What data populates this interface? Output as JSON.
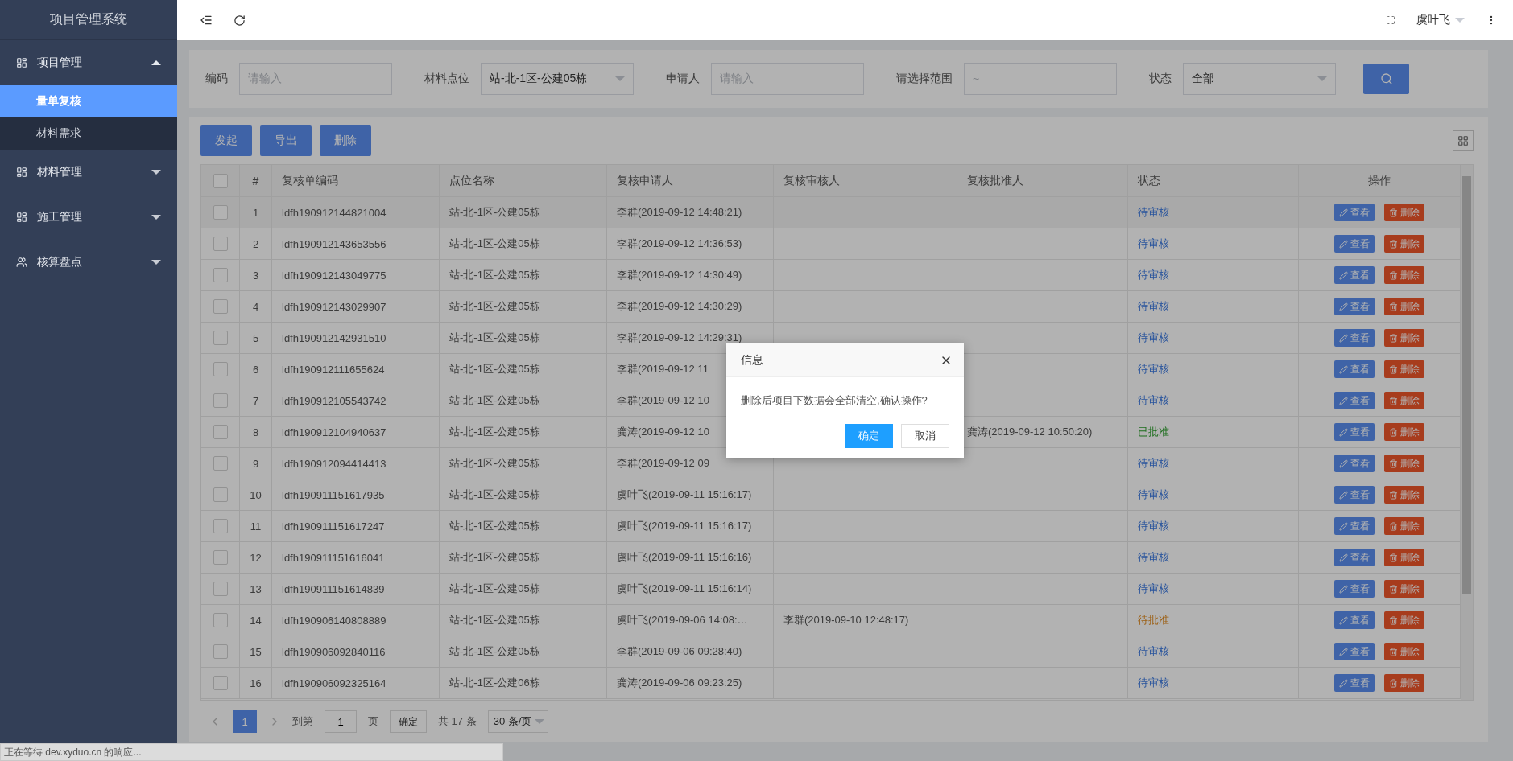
{
  "sidebar": {
    "title": "项目管理系统",
    "menus": [
      {
        "label": "项目管理",
        "kind": "module",
        "expanded": true,
        "children": [
          {
            "label": "量单复核",
            "selected": true
          },
          {
            "label": "材料需求",
            "selected": false
          }
        ]
      },
      {
        "label": "材料管理",
        "kind": "module",
        "expanded": false
      },
      {
        "label": "施工管理",
        "kind": "module",
        "expanded": false
      },
      {
        "label": "核算盘点",
        "kind": "account",
        "expanded": false
      }
    ]
  },
  "header": {
    "user": "虞叶飞"
  },
  "filters": [
    {
      "label": "编码",
      "kind": "input",
      "placeholder": "请输入"
    },
    {
      "label": "材料点位",
      "kind": "select",
      "value": "站-北-1区-公建05栋"
    },
    {
      "label": "申请人",
      "kind": "input",
      "placeholder": "请输入"
    },
    {
      "label": "请选择范围",
      "kind": "range",
      "placeholder": "~"
    },
    {
      "label": "状态",
      "kind": "select",
      "value": "全部"
    }
  ],
  "toolbar": [
    "发起",
    "导出",
    "删除"
  ],
  "table": {
    "all_checked": false,
    "columns": [
      "#",
      "复核单编码",
      "点位名称",
      "复核申请人",
      "复核审核人",
      "复核批准人",
      "状态",
      "操作"
    ],
    "rows": [
      {
        "checked": false,
        "no": "1",
        "code": "ldfh190912144821004",
        "site": "站-北-1区-公建05栋",
        "applicant": "李群(2019-09-12 14:48:21)",
        "status": {
          "text": "待审核",
          "kind": "pending"
        },
        "actions": [
          "查看",
          "删除"
        ]
      },
      {
        "checked": false,
        "no": "2",
        "code": "ldfh190912143653556",
        "site": "站-北-1区-公建05栋",
        "applicant": "李群(2019-09-12 14:36:53)",
        "status": {
          "text": "待审核",
          "kind": "pending"
        },
        "actions": [
          "查看",
          "删除"
        ]
      },
      {
        "checked": false,
        "no": "3",
        "code": "ldfh190912143049775",
        "site": "站-北-1区-公建05栋",
        "applicant": "李群(2019-09-12 14:30:49)",
        "status": {
          "text": "待审核",
          "kind": "pending"
        },
        "actions": [
          "查看",
          "删除"
        ]
      },
      {
        "checked": false,
        "no": "4",
        "code": "ldfh190912143029907",
        "site": "站-北-1区-公建05栋",
        "applicant": "李群(2019-09-12 14:30:29)",
        "status": {
          "text": "待审核",
          "kind": "pending"
        },
        "actions": [
          "查看",
          "删除"
        ]
      },
      {
        "checked": false,
        "no": "5",
        "code": "ldfh190912142931510",
        "site": "站-北-1区-公建05栋",
        "applicant": "李群(2019-09-12 14:29:31)",
        "status": {
          "text": "待审核",
          "kind": "pending"
        },
        "actions": [
          "查看",
          "删除"
        ]
      },
      {
        "checked": false,
        "no": "6",
        "code": "ldfh190912111655624",
        "site": "站-北-1区-公建05栋",
        "applicant": "李群(2019-09-12 11",
        "status": {
          "text": "待审核",
          "kind": "pending"
        },
        "actions": [
          "查看",
          "删除"
        ]
      },
      {
        "checked": false,
        "no": "7",
        "code": "ldfh190912105543742",
        "site": "站-北-1区-公建05栋",
        "applicant": "李群(2019-09-12 10",
        "status": {
          "text": "待审核",
          "kind": "pending"
        },
        "actions": [
          "查看",
          "删除"
        ]
      },
      {
        "checked": false,
        "no": "8",
        "code": "ldfh190912104940637",
        "site": "站-北-1区-公建05栋",
        "applicant": "龚涛(2019-09-12 10",
        "approver": "龚涛(2019-09-12 10:50:20)",
        "status": {
          "text": "已批准",
          "kind": "approved"
        },
        "actions": [
          "查看",
          "删除"
        ]
      },
      {
        "checked": false,
        "no": "9",
        "code": "ldfh190912094414413",
        "site": "站-北-1区-公建05栋",
        "applicant": "李群(2019-09-12 09",
        "status": {
          "text": "待审核",
          "kind": "pending"
        },
        "actions": [
          "查看",
          "删除"
        ]
      },
      {
        "checked": false,
        "no": "10",
        "code": "ldfh190911151617935",
        "site": "站-北-1区-公建05栋",
        "applicant": "虞叶飞(2019-09-11 15:16:17)",
        "status": {
          "text": "待审核",
          "kind": "pending"
        },
        "actions": [
          "查看",
          "删除"
        ]
      },
      {
        "checked": false,
        "no": "11",
        "code": "ldfh190911151617247",
        "site": "站-北-1区-公建05栋",
        "applicant": "虞叶飞(2019-09-11 15:16:17)",
        "status": {
          "text": "待审核",
          "kind": "pending"
        },
        "actions": [
          "查看",
          "删除"
        ]
      },
      {
        "checked": false,
        "no": "12",
        "code": "ldfh190911151616041",
        "site": "站-北-1区-公建05栋",
        "applicant": "虞叶飞(2019-09-11 15:16:16)",
        "status": {
          "text": "待审核",
          "kind": "pending"
        },
        "actions": [
          "查看",
          "删除"
        ]
      },
      {
        "checked": false,
        "no": "13",
        "code": "ldfh190911151614839",
        "site": "站-北-1区-公建05栋",
        "applicant": "虞叶飞(2019-09-11 15:16:14)",
        "status": {
          "text": "待审核",
          "kind": "pending"
        },
        "actions": [
          "查看",
          "删除"
        ]
      },
      {
        "checked": false,
        "no": "14",
        "code": "ldfh190906140808889",
        "site": "站-北-1区-公建05栋",
        "applicant": "虞叶飞(2019-09-06 14:08:…",
        "reviewer": "李群(2019-09-10 12:48:17)",
        "status": {
          "text": "待批准",
          "kind": "awaiting"
        },
        "actions": [
          "查看",
          "删除"
        ]
      },
      {
        "checked": false,
        "no": "15",
        "code": "ldfh190906092840116",
        "site": "站-北-1区-公建05栋",
        "applicant": "李群(2019-09-06 09:28:40)",
        "status": {
          "text": "待审核",
          "kind": "pending"
        },
        "actions": [
          "查看",
          "删除"
        ]
      },
      {
        "checked": false,
        "no": "16",
        "code": "ldfh190906092325164",
        "site": "站-北-1区-公建06栋",
        "applicant": "龚涛(2019-09-06 09:23:25)",
        "status": {
          "text": "待审核",
          "kind": "pending"
        },
        "actions": [
          "查看",
          "删除"
        ]
      }
    ]
  },
  "pagination": {
    "pages": [
      {
        "label": "1",
        "selected": true
      }
    ],
    "goto_label": "到第",
    "goto_value": "1",
    "page_unit": "页",
    "confirm": "确定",
    "total": "共 17 条",
    "page_size": "30 条/页"
  },
  "dialog": {
    "title": "信息",
    "message": "删除后项目下数据会全部清空,确认操作?",
    "buttons": [
      {
        "label": "确定",
        "kind": "primary"
      },
      {
        "label": "取消",
        "kind": "default"
      }
    ]
  },
  "browser_status": "正在等待 dev.xyduo.cn 的响应..."
}
